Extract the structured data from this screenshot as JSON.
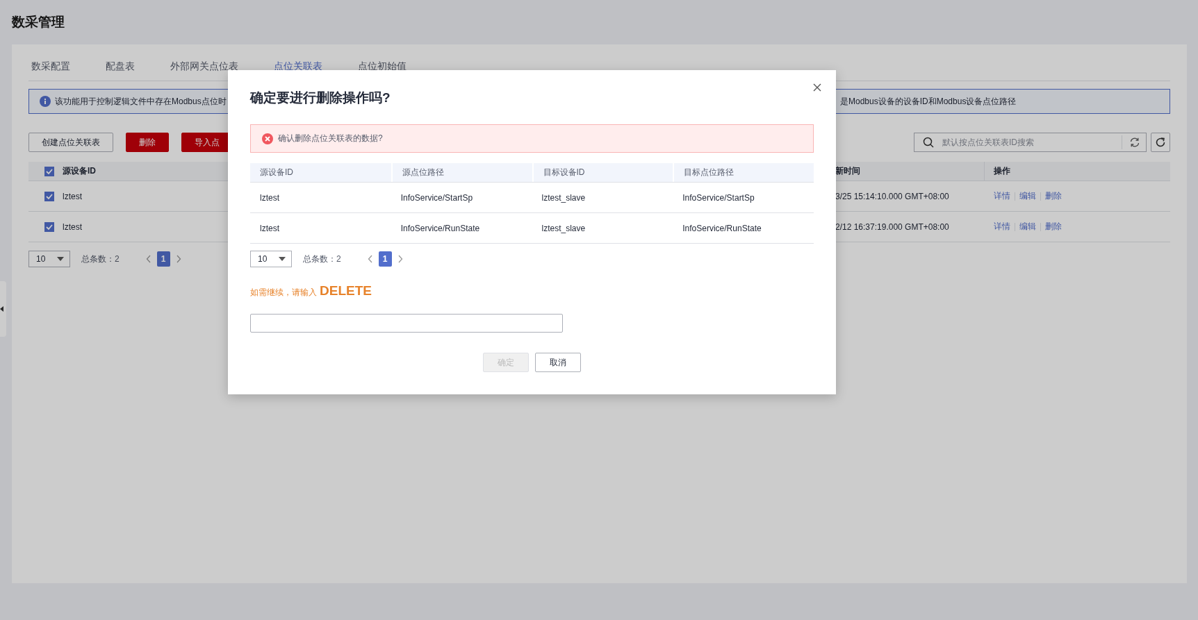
{
  "page": {
    "title": "数采管理"
  },
  "tabs": [
    {
      "label": "数采配置",
      "selected": false
    },
    {
      "label": "配盘表",
      "selected": false
    },
    {
      "label": "外部网关点位表",
      "selected": false
    },
    {
      "label": "点位关联表",
      "selected": true
    },
    {
      "label": "点位初始值",
      "selected": false
    }
  ],
  "info": {
    "text_start": "该功能用于控制逻辑文件中存在Modbus点位时",
    "text_end": "是Modbus设备的设备ID和Modbus设备点位路径"
  },
  "toolbar": {
    "buttons": [
      {
        "label": "创建点位关联表",
        "kind": "default"
      },
      {
        "label": "删除",
        "kind": "danger"
      },
      {
        "label": "导入点",
        "kind": "danger"
      }
    ],
    "search": {
      "placeholder": "默认按点位关联表ID搜索"
    }
  },
  "table": {
    "header_checked": true,
    "columns": [
      "源设备ID",
      "新时间",
      "操作"
    ],
    "rows": [
      {
        "checked": true,
        "cells": [
          "lztest",
          "3/25 15:14:10.000 GMT+08:00"
        ],
        "actions": [
          "详情",
          "编辑",
          "删除"
        ]
      },
      {
        "checked": true,
        "cells": [
          "lztest",
          "2/12 16:37:19.000 GMT+08:00"
        ],
        "actions": [
          "详情",
          "编辑",
          "删除"
        ]
      }
    ]
  },
  "pagination": {
    "page_size": "10",
    "total": "总条数：2",
    "pages": [
      {
        "label": "1",
        "selected": true
      }
    ]
  },
  "dialog": {
    "title": "确定要进行删除操作吗?",
    "alert": "确认删除点位关联表的数据?",
    "columns": [
      "源设备ID",
      "源点位路径",
      "目标设备ID",
      "目标点位路径"
    ],
    "rows": [
      [
        "lztest",
        "InfoService/StartSp",
        "lztest_slave",
        "InfoService/StartSp"
      ],
      [
        "lztest",
        "InfoService/RunState",
        "lztest_slave",
        "InfoService/RunState"
      ]
    ],
    "pagination": {
      "page_size": "10",
      "total": "总条数：2",
      "pages": [
        {
          "label": "1",
          "selected": true
        }
      ]
    },
    "prompt": "如需继续，请输入",
    "keyword": "DELETE",
    "buttons": [
      {
        "label": "确定",
        "kind": "primary",
        "disabled": true
      },
      {
        "label": "取消",
        "kind": "default",
        "disabled": false
      }
    ]
  }
}
